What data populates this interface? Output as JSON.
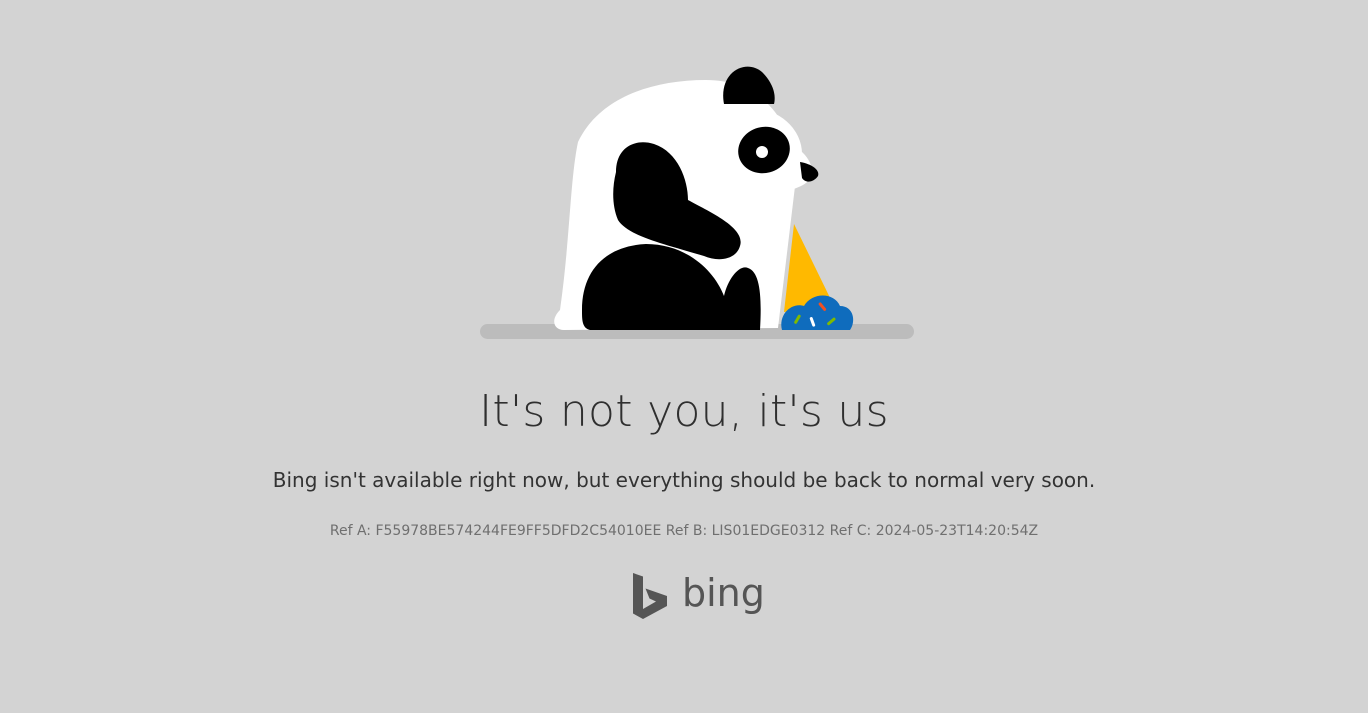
{
  "page": {
    "headline": "It's not you, it's us",
    "message": "Bing isn't available right now, but everything should be back to normal very soon.",
    "refs": {
      "ref_a_label": "Ref A:",
      "ref_a_value": "F55978BE574244FE9FF5DFD2C54010EE",
      "ref_b_label": "Ref B:",
      "ref_b_value": "LIS01EDGE0312",
      "ref_c_label": "Ref C:",
      "ref_c_value": "2024-05-23T14:20:54Z"
    },
    "logo": {
      "wordmark": "bing",
      "icon": "bing-logo-icon"
    },
    "illustration": {
      "icon": "sad-panda-dropped-ice-cream-illustration"
    }
  },
  "colors": {
    "background": "#d3d3d3",
    "headline": "#2f2f2f",
    "text": "#333333",
    "refs": "#6f6f6f",
    "logo": "#555555",
    "cone": "#ffb900",
    "ice_cream": "#0f6cbd"
  }
}
